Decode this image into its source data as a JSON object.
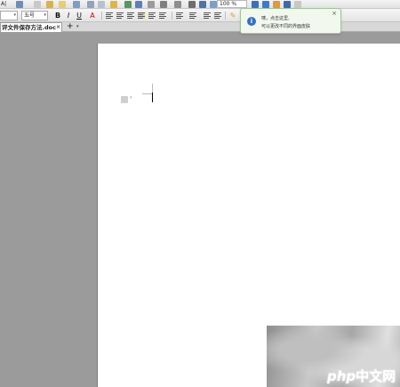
{
  "toolbar1": {
    "zoom": "100 %"
  },
  "toolbar2": {
    "font_size": "五号",
    "bold": "B",
    "italic": "I",
    "underline": "U",
    "font_color": "A"
  },
  "tabs": {
    "document_tab_label": "评文件保存方法.doc",
    "close_glyph": "×",
    "new_tab_glyph": "+"
  },
  "notification": {
    "line1": "咦，点击这里,",
    "line2": "可以更改不同的界面皮肤",
    "close_glyph": "×"
  },
  "watermark": {
    "brand_latin": "php",
    "brand_cn": "中文网"
  },
  "colors": {
    "workspace_bg": "#9b9b9b",
    "notify_bg": "#f3f8ee",
    "notify_border": "#9fc69a",
    "info_icon": "#2f6fd0"
  }
}
